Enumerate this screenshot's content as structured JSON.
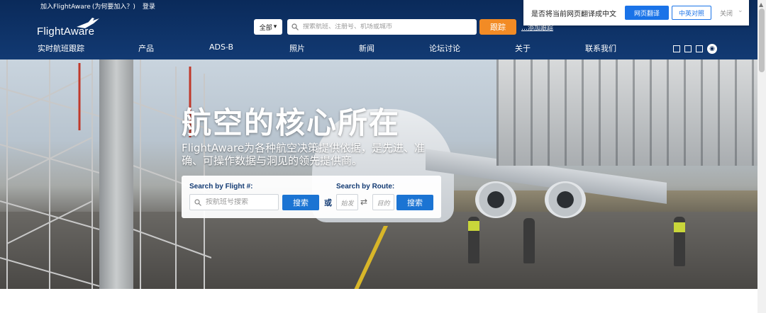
{
  "topbar": {
    "join": "加入FlightAware",
    "why_join": "(为何要加入？)",
    "login": "登录"
  },
  "logo": {
    "text": "FlightAware"
  },
  "search": {
    "scope": "全部",
    "placeholder": "搜索航班、注册号、机场或城市",
    "button": "跟踪",
    "note": "…添加跟踪"
  },
  "nav": {
    "items": [
      {
        "label": "实时航班跟踪"
      },
      {
        "label": "产品"
      },
      {
        "label": "ADS-B"
      },
      {
        "label": "照片"
      },
      {
        "label": "新闻"
      },
      {
        "label": "论坛讨论"
      },
      {
        "label": "关于"
      },
      {
        "label": "联系我们"
      }
    ],
    "social_icons": [
      "square-icon",
      "square-icon",
      "square-icon",
      "weibo-icon"
    ]
  },
  "hero": {
    "title": "航空的核心所在",
    "subtitle": "FlightAware为各种航空决策提供依据，是先进、准确、可操作数据与洞见的领先提供商。",
    "flight_label": "Search by Flight #:",
    "flight_placeholder": "按航班号搜索",
    "flight_button": "搜索",
    "or": "或",
    "route_label": "Search by Route:",
    "origin_placeholder": "始发",
    "destination_placeholder": "目的",
    "route_button": "搜索"
  },
  "translate_bar": {
    "prompt": "是否将当前网页翻译成中文",
    "translate": "网页翻译",
    "bilingual": "中英对照",
    "close": "关闭"
  },
  "colors": {
    "header": "#0a2a5a",
    "accent_orange": "#f28b25",
    "button_blue": "#1b74d3"
  }
}
